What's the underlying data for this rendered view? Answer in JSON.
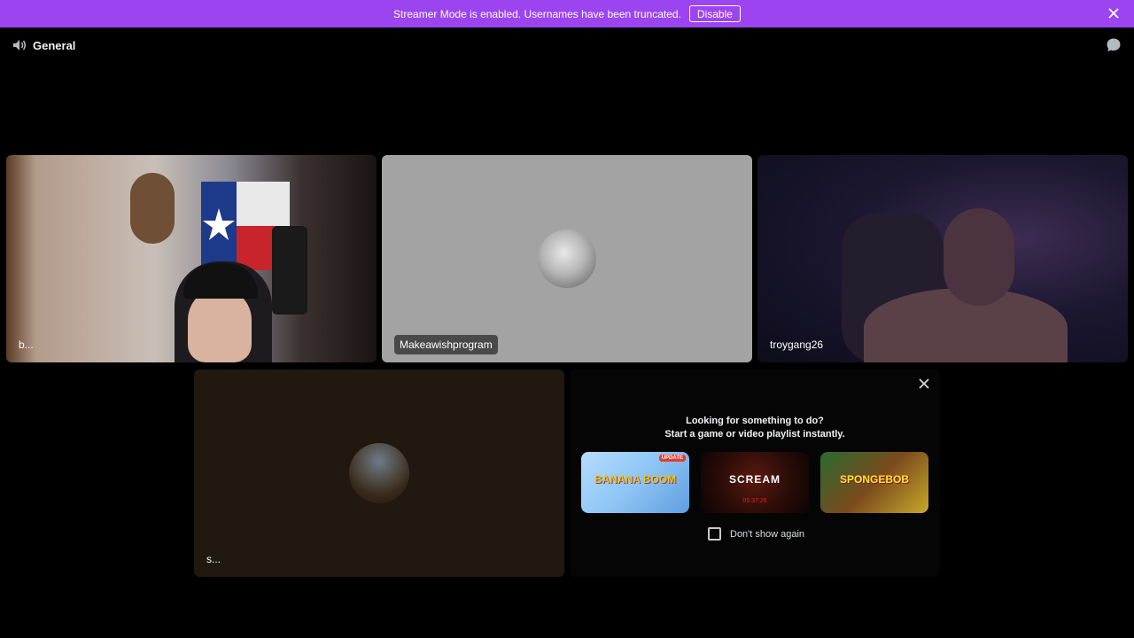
{
  "banner": {
    "message": "Streamer Mode is enabled. Usernames have been truncated.",
    "disable_label": "Disable",
    "background": "#9b44f0"
  },
  "header": {
    "channel_icon": "speaker-icon",
    "channel_name": "General",
    "chat_icon": "chat-bubble-icon"
  },
  "tiles": [
    {
      "label": "b..."
    },
    {
      "label": "Makeawishprogram"
    },
    {
      "label": "troygang26"
    },
    {
      "label": "s..."
    }
  ],
  "suggestion": {
    "line1": "Looking for something to do?",
    "line2": "Start a game or video playlist instantly.",
    "cards": [
      {
        "title": "BANANA BOOM",
        "badge": "UPDATE"
      },
      {
        "title": "SCREAM",
        "subtitle": "05:37:26"
      },
      {
        "title": "SPONGEBOB"
      }
    ],
    "dont_show_label": "Don't show again"
  }
}
